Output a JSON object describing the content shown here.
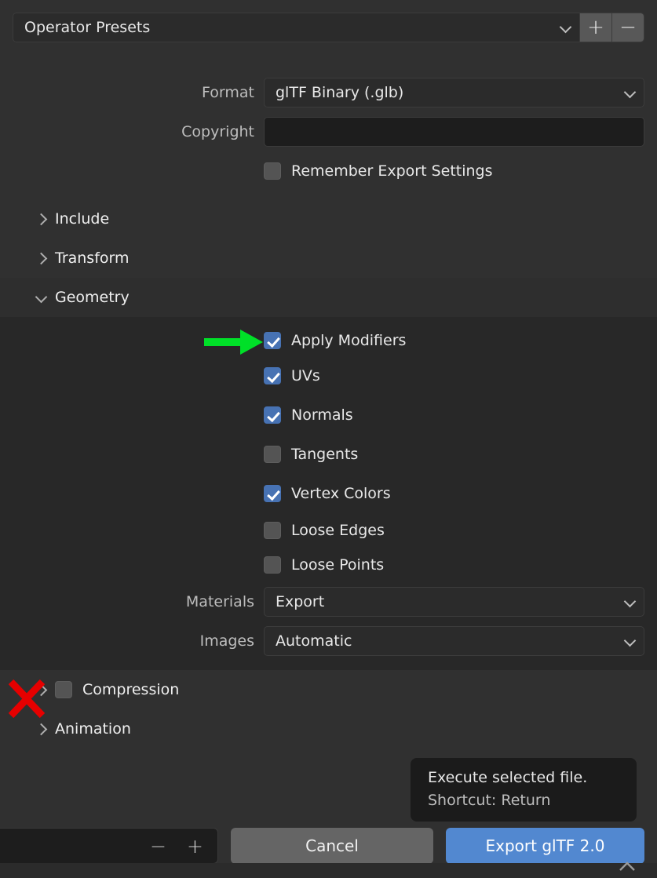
{
  "preset": {
    "label": "Operator Presets",
    "dropdown_icon": "chevron-down-icon",
    "add_label": "+",
    "remove_label": "−"
  },
  "fields": {
    "format": {
      "label": "Format",
      "value": "glTF Binary (.glb)",
      "dropdown_icon": "chevron-down-icon"
    },
    "copyright": {
      "label": "Copyright",
      "value": "",
      "placeholder": ""
    },
    "remember_export_settings": {
      "label": "Remember Export Settings",
      "checked": false
    }
  },
  "sections": {
    "include": {
      "label": "Include",
      "expanded": false,
      "icon": "chevron-right-icon"
    },
    "transform": {
      "label": "Transform",
      "expanded": false,
      "icon": "chevron-right-icon"
    },
    "geometry": {
      "label": "Geometry",
      "expanded": true,
      "icon": "chevron-down-icon"
    },
    "compression": {
      "label": "Compression",
      "expanded": false,
      "icon": "chevron-right-icon",
      "checked": false
    },
    "animation": {
      "label": "Animation",
      "expanded": false,
      "icon": "chevron-right-icon"
    }
  },
  "geometry": {
    "checkboxes": [
      {
        "label": "Apply Modifiers",
        "checked": true
      },
      {
        "label": "UVs",
        "checked": true
      },
      {
        "label": "Normals",
        "checked": true
      },
      {
        "label": "Tangents",
        "checked": false
      },
      {
        "label": "Vertex Colors",
        "checked": true
      },
      {
        "label": "Loose Edges",
        "checked": false
      },
      {
        "label": "Loose Points",
        "checked": false
      }
    ],
    "materials": {
      "label": "Materials",
      "value": "Export",
      "dropdown_icon": "chevron-down-icon"
    },
    "images": {
      "label": "Images",
      "value": "Automatic",
      "dropdown_icon": "chevron-down-icon"
    }
  },
  "tooltip": {
    "line1": "Execute selected file.",
    "line2": "Shortcut: Return"
  },
  "footer": {
    "number_field_value": "",
    "decrement_label": "−",
    "increment_label": "+",
    "cancel_label": "Cancel",
    "export_label": "Export glTF 2.0",
    "grab_icon": "chevron-up-icon"
  },
  "annotations": {
    "arrow": {
      "target": "Apply Modifiers",
      "color": "#00e028",
      "icon": "arrow-right-annotation"
    },
    "cross": {
      "target": "Compression",
      "color": "#e60000",
      "icon": "x-mark-annotation"
    }
  },
  "colors": {
    "window_bg": "#303030",
    "panel_header_bg": "#2e2e2e",
    "panel_body_bg": "#282828",
    "field_bg": "#2b2b2b",
    "text_input_bg": "#1d1d1d",
    "checkbox_on": "#4772b3",
    "checkbox_off": "#545454",
    "accent_button": "#5288d0",
    "cancel_button": "#656565",
    "tooltip_bg": "#1b1b1b"
  }
}
